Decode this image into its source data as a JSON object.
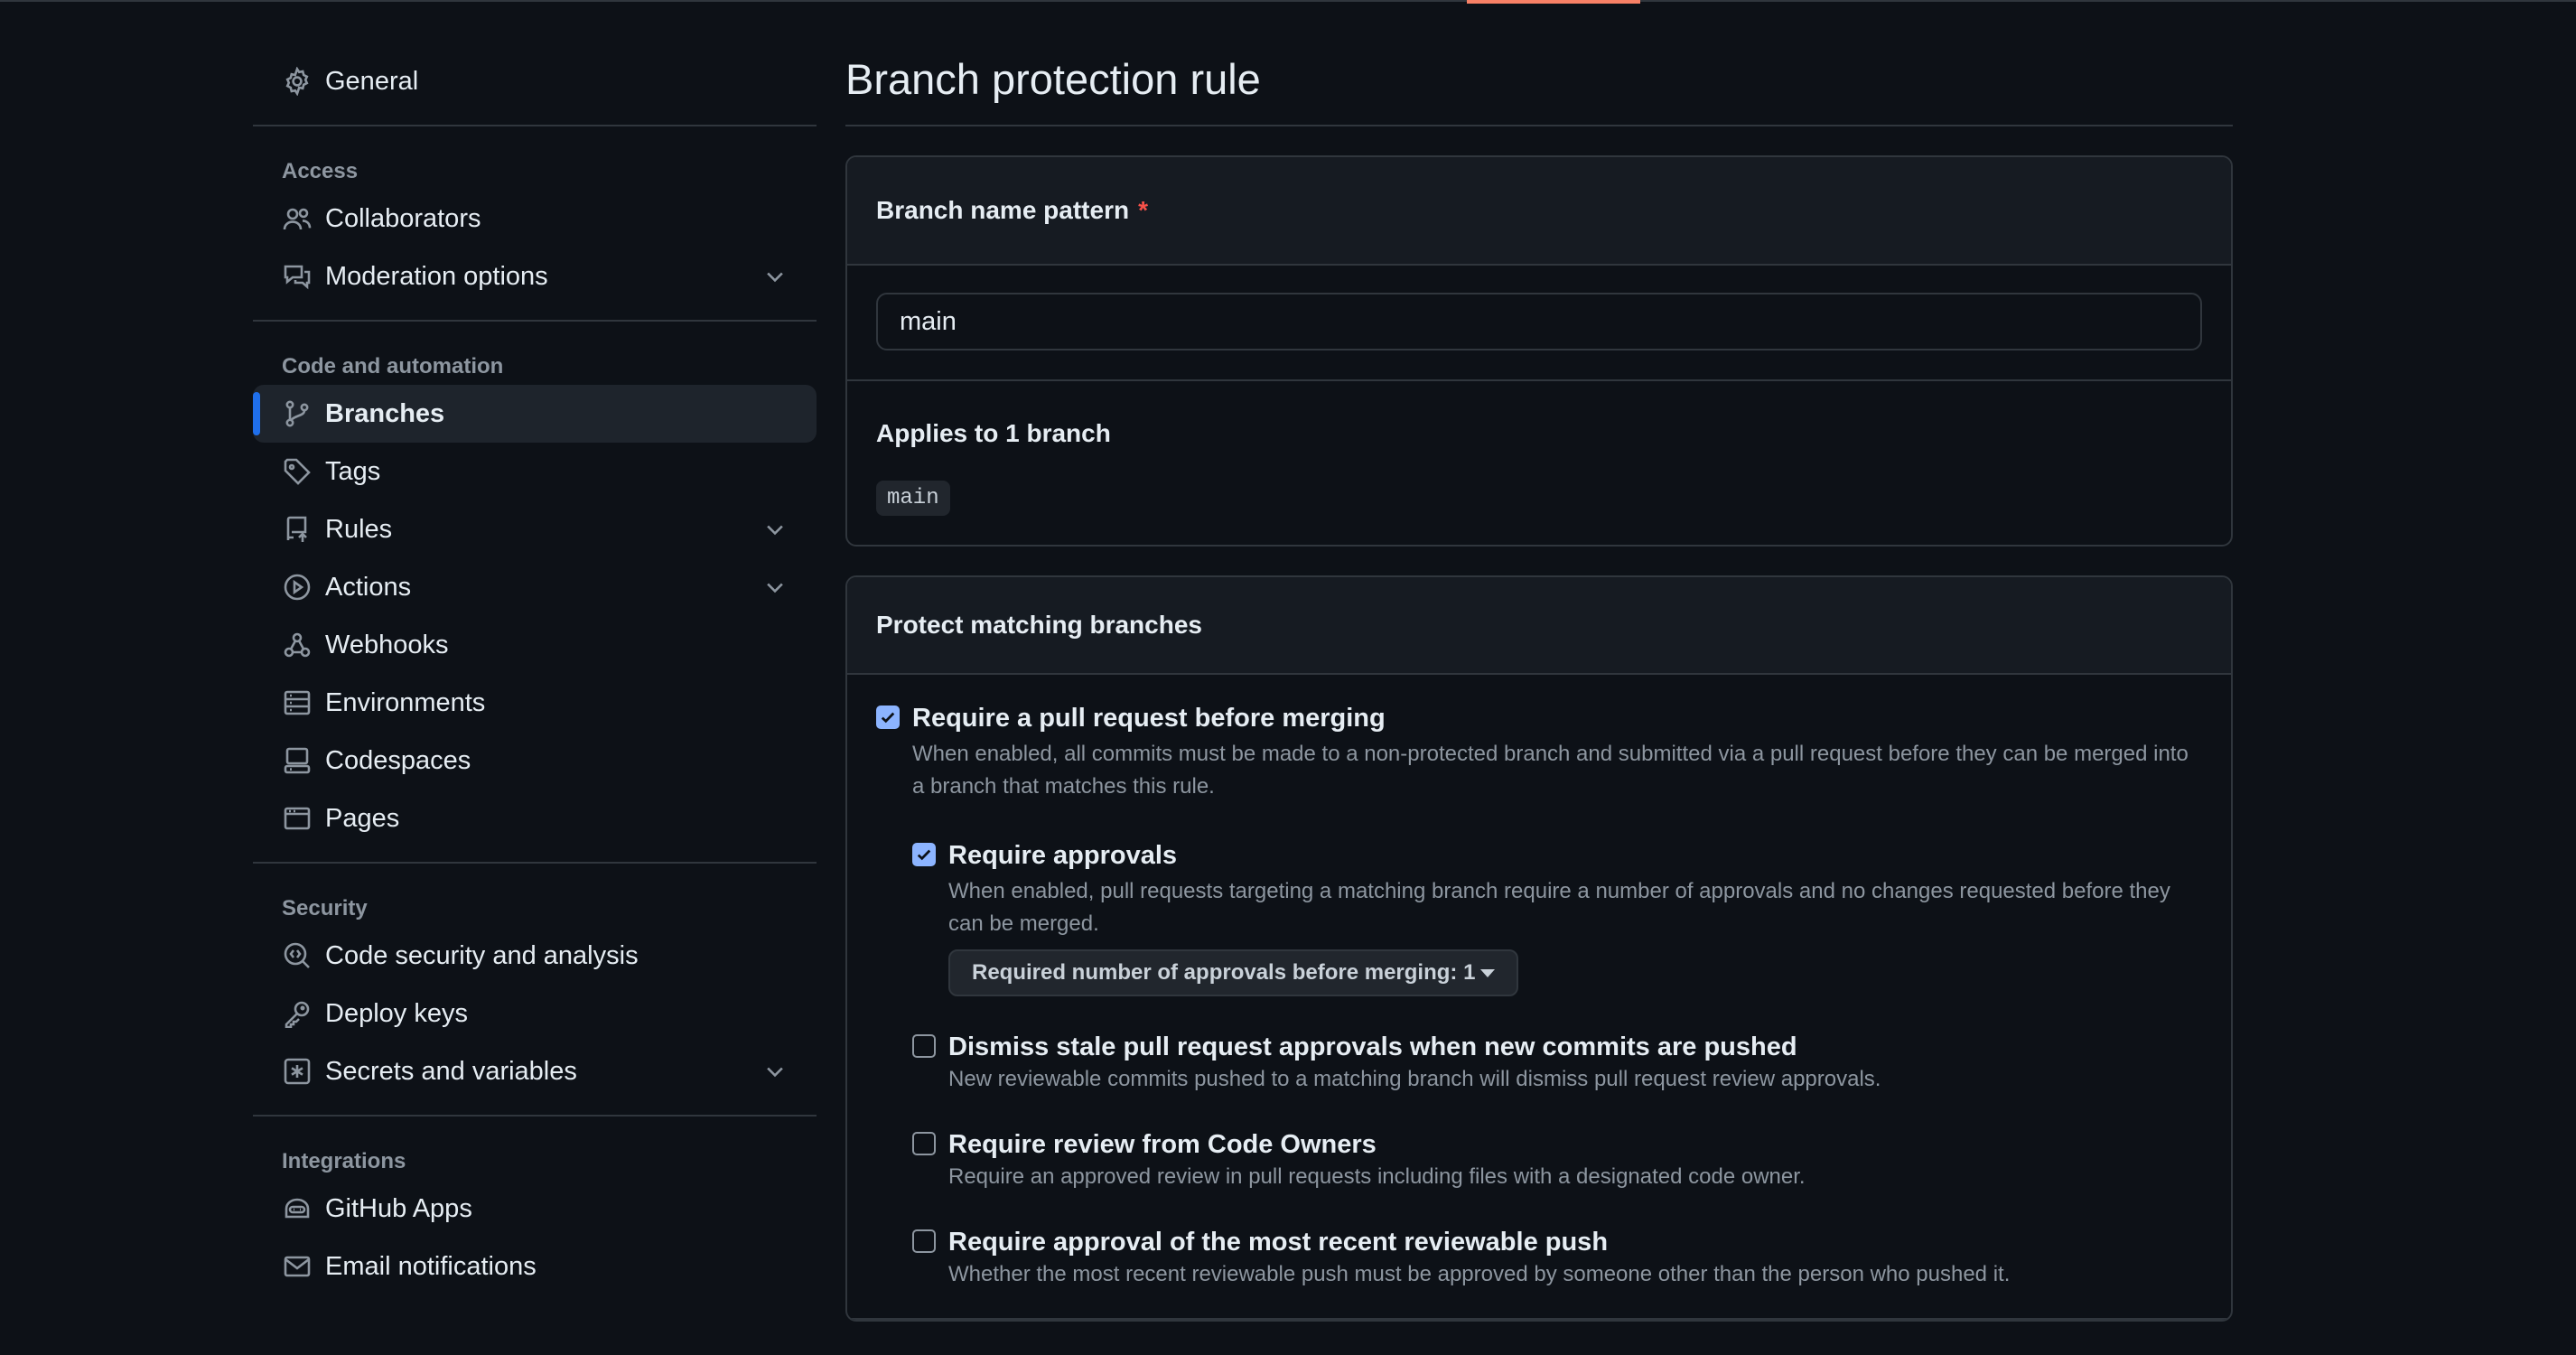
{
  "colors": {
    "background": "#0d1117",
    "accent_active": "#1f6feb",
    "tab_underline": "#f78166",
    "required_star": "#f85149",
    "checkbox_checked": "#8cb4ff"
  },
  "sidebar": {
    "general": {
      "label": "General",
      "icon": "gear-icon"
    },
    "groups": {
      "access": {
        "label": "Access",
        "items": [
          {
            "label": "Collaborators",
            "icon": "people-icon"
          },
          {
            "label": "Moderation options",
            "icon": "comment-discussion-icon",
            "expandable": true
          }
        ]
      },
      "code": {
        "label": "Code and automation",
        "items": [
          {
            "label": "Branches",
            "icon": "git-branch-icon",
            "active": true
          },
          {
            "label": "Tags",
            "icon": "tag-icon"
          },
          {
            "label": "Rules",
            "icon": "repo-push-icon",
            "expandable": true
          },
          {
            "label": "Actions",
            "icon": "play-icon",
            "expandable": true
          },
          {
            "label": "Webhooks",
            "icon": "webhook-icon"
          },
          {
            "label": "Environments",
            "icon": "server-icon"
          },
          {
            "label": "Codespaces",
            "icon": "codespaces-icon"
          },
          {
            "label": "Pages",
            "icon": "browser-icon"
          }
        ]
      },
      "security": {
        "label": "Security",
        "items": [
          {
            "label": "Code security and analysis",
            "icon": "codescan-icon"
          },
          {
            "label": "Deploy keys",
            "icon": "key-icon"
          },
          {
            "label": "Secrets and variables",
            "icon": "asterisk-icon",
            "expandable": true
          }
        ]
      },
      "integrations": {
        "label": "Integrations",
        "items": [
          {
            "label": "GitHub Apps",
            "icon": "hubot-icon"
          },
          {
            "label": "Email notifications",
            "icon": "mail-icon"
          }
        ]
      }
    }
  },
  "main": {
    "title": "Branch protection rule",
    "pattern": {
      "label": "Branch name pattern",
      "required_mark": "*",
      "value": "main",
      "applies_text": "Applies to 1 branch",
      "branches": [
        "main"
      ]
    },
    "protect": {
      "title": "Protect matching branches",
      "options": [
        {
          "checked": true,
          "title": "Require a pull request before merging",
          "desc": "When enabled, all commits must be made to a non-protected branch and submitted via a pull request before they can be merged into a branch that matches this rule."
        },
        {
          "checked": true,
          "title": "Require approvals",
          "desc": "When enabled, pull requests targeting a matching branch require a number of approvals and no changes requested before they can be merged.",
          "select_label": "Required number of approvals before merging: 1"
        },
        {
          "checked": false,
          "title": "Dismiss stale pull request approvals when new commits are pushed",
          "desc": "New reviewable commits pushed to a matching branch will dismiss pull request review approvals."
        },
        {
          "checked": false,
          "title": "Require review from Code Owners",
          "desc": "Require an approved review in pull requests including files with a designated code owner."
        },
        {
          "checked": false,
          "title": "Require approval of the most recent reviewable push",
          "desc": "Whether the most recent reviewable push must be approved by someone other than the person who pushed it."
        }
      ]
    }
  }
}
